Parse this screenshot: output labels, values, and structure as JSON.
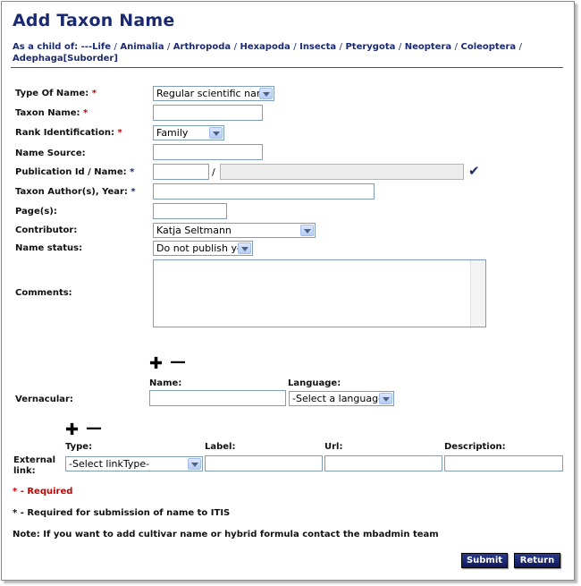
{
  "page": {
    "title": "Add Taxon Name",
    "breadcrumb_prefix": "As a child of:",
    "breadcrumb": [
      "---Life",
      "Animalia",
      "Arthropoda",
      "Hexapoda",
      "Insecta",
      "Pterygota",
      "Neoptera",
      "Coleoptera",
      "Adephaga[Suborder]"
    ],
    "breadcrumb_sep": "/"
  },
  "form": {
    "type_of_name": {
      "label": "Type Of Name:",
      "value": "Regular scientific name"
    },
    "taxon_name": {
      "label": "Taxon Name:",
      "value": ""
    },
    "rank": {
      "label": "Rank Identification:",
      "value": "Family"
    },
    "name_source": {
      "label": "Name Source:",
      "value": ""
    },
    "publication": {
      "label": "Publication Id / Name:",
      "id_value": "",
      "slash": "/",
      "name_value": ""
    },
    "author_year": {
      "label": "Taxon Author(s), Year:",
      "value": ""
    },
    "pages": {
      "label": "Page(s):",
      "value": ""
    },
    "contributor": {
      "label": "Contributor:",
      "value": "Katja Seltmann"
    },
    "name_status": {
      "label": "Name status:",
      "value": "Do not publish yet"
    },
    "comments": {
      "label": "Comments:",
      "value": ""
    },
    "required_star": "*",
    "check_icon": "✔"
  },
  "vernacular": {
    "label": "Vernacular:",
    "name_header": "Name:",
    "language_header": "Language:",
    "language_value": "-Select a language-",
    "plus": "✚",
    "minus": "—"
  },
  "external_link": {
    "label_line1": "External",
    "label_line2": "link:",
    "type_header": "Type:",
    "label_header": "Label:",
    "url_header": "Url:",
    "description_header": "Description:",
    "type_value": "-Select linkType-",
    "plus": "✚",
    "minus": "—"
  },
  "notes": {
    "required": "* - Required",
    "required_itis": "* - Required for submission of name to ITIS",
    "cultivar": "Note: If you want to add cultivar name or hybrid formula contact the mbadmin team"
  },
  "buttons": {
    "submit": "Submit",
    "return": "Return"
  },
  "colors": {
    "title": "#1b2a70",
    "required": "#cc0000",
    "button": "#1b2a70"
  }
}
